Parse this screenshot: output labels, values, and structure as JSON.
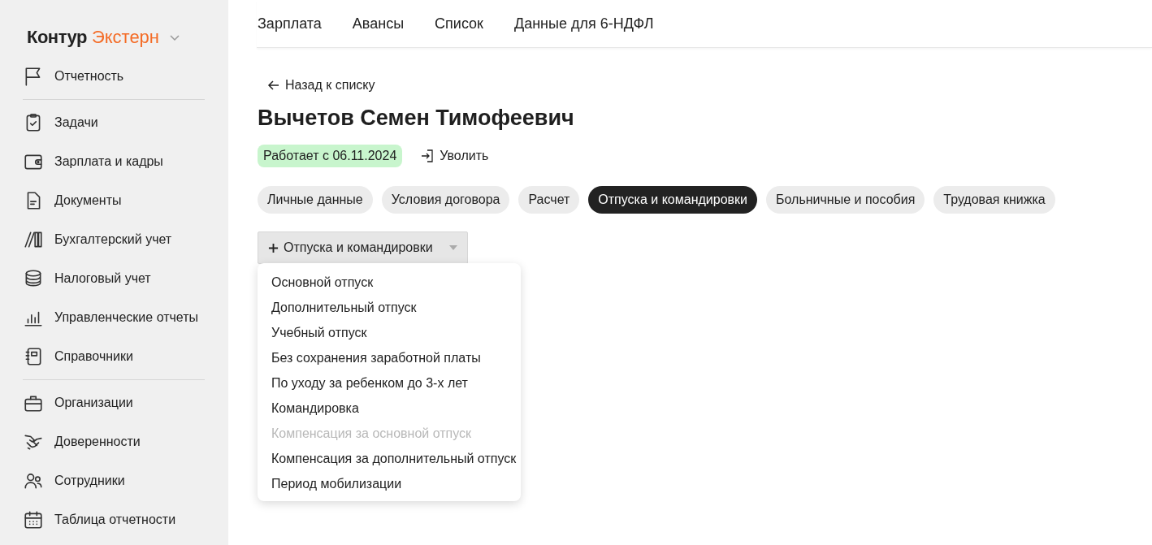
{
  "brand": {
    "name": "Контур",
    "product": "Экстерн"
  },
  "sidebar": {
    "groups": [
      {
        "items": [
          {
            "label": "Отчетность"
          }
        ]
      },
      {
        "items": [
          {
            "label": "Задачи"
          },
          {
            "label": "Зарплата и кадры"
          },
          {
            "label": "Документы"
          },
          {
            "label": "Бухгалтерский учет"
          },
          {
            "label": "Налоговый учет"
          },
          {
            "label": "Управленческие отчеты"
          },
          {
            "label": "Справочники"
          }
        ]
      },
      {
        "items": [
          {
            "label": "Организации"
          },
          {
            "label": "Доверенности"
          },
          {
            "label": "Сотрудники"
          },
          {
            "label": "Таблица отчетности"
          }
        ]
      }
    ]
  },
  "top_nav": [
    "Зарплата",
    "Авансы",
    "Список",
    "Данные для 6-НДФЛ"
  ],
  "back_link": "Назад к списку",
  "employee_name": "Вычетов Семен Тимофеевич",
  "status_badge": "Работает с 06.11.2024",
  "dismiss_button": "Уволить",
  "tabs": [
    {
      "label": "Личные данные",
      "selected": false
    },
    {
      "label": "Условия договора",
      "selected": false
    },
    {
      "label": "Расчет",
      "selected": false
    },
    {
      "label": "Отпуска и командировки",
      "selected": true
    },
    {
      "label": "Больничные и пособия",
      "selected": false
    },
    {
      "label": "Трудовая книжка",
      "selected": false
    }
  ],
  "add_dropdown": {
    "label": "Отпуска и командировки",
    "expanded": true,
    "options": [
      {
        "label": "Основной отпуск",
        "disabled": false
      },
      {
        "label": "Дополнительный отпуск",
        "disabled": false
      },
      {
        "label": "Учебный отпуск",
        "disabled": false
      },
      {
        "label": "Без сохранения заработной платы",
        "disabled": false
      },
      {
        "label": "По уходу за ребенком до 3-х лет",
        "disabled": false
      },
      {
        "label": "Командировка",
        "disabled": false
      },
      {
        "label": "Компенсация за основной отпуск",
        "disabled": true
      },
      {
        "label": "Компенсация за дополнительный отпуск",
        "disabled": false
      },
      {
        "label": "Период мобилизации",
        "disabled": false
      }
    ]
  }
}
